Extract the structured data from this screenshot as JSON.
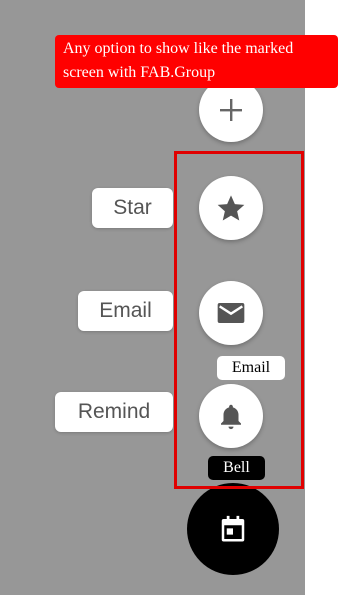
{
  "annotation": {
    "text": "Any option to show like the marked screen with FAB.Group"
  },
  "fab_group": {
    "toggle_icon": "plus-icon",
    "main_icon": "calendar-icon",
    "actions": [
      {
        "label": "Star",
        "icon": "star-icon"
      },
      {
        "label": "Email",
        "icon": "email-icon"
      },
      {
        "label": "Remind",
        "icon": "bell-icon"
      }
    ]
  },
  "tooltips": {
    "email": "Email",
    "bell": "Bell"
  },
  "colors": {
    "overlay": "#979797",
    "highlight_border": "#e00000",
    "annotation_bg": "#ff0000",
    "icon": "#555555"
  }
}
